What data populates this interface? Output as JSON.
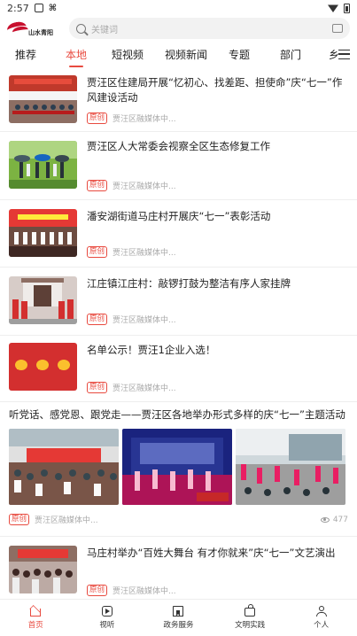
{
  "status_bar": {
    "time": "2:57",
    "indicators": [
      "wifi-icon",
      "battery-icon"
    ]
  },
  "header": {
    "logo_text": "山水青阳",
    "search_placeholder": "关键词"
  },
  "tabs": [
    {
      "label": "推荐",
      "active": false
    },
    {
      "label": "本地",
      "active": true
    },
    {
      "label": "短视频",
      "active": false
    },
    {
      "label": "视频新闻",
      "active": false
    },
    {
      "label": "专题",
      "active": false
    },
    {
      "label": "部门",
      "active": false
    },
    {
      "label": "乡",
      "active": false
    }
  ],
  "feed": [
    {
      "title": "贾汪区住建局开展“忆初心、找差距、担使命”庆“七一”作风建设活动",
      "badge": "原创",
      "source": "贾汪区融媒体中..."
    },
    {
      "title": "贾汪区人大常委会视察全区生态修复工作",
      "badge": "原创",
      "source": "贾汪区融媒体中..."
    },
    {
      "title": "潘安湖街道马庄村开展庆“七一”表彰活动",
      "badge": "原创",
      "source": "贾汪区融媒体中..."
    },
    {
      "title": "江庄镇江庄村：敲锣打鼓为整洁有序人家挂牌",
      "badge": "原创",
      "source": "贾汪区融媒体中..."
    },
    {
      "title": "名单公示！贾汪1企业入选！",
      "badge": "原创",
      "source": "贾汪区融媒体中..."
    }
  ],
  "gallery_item": {
    "title": "听党话、感党恩、跟党走——贾汪区各地举办形式多样的庆“七一”主题活动",
    "badge": "原创",
    "source": "贾汪区融媒体中...",
    "views": "477"
  },
  "last_item": {
    "title": "马庄村举办“百姓大舞台 有才你就来”庆“七一”文艺演出",
    "badge": "原创",
    "source": "贾汪区融媒体中..."
  },
  "bottom_nav": [
    {
      "label": "首页",
      "icon": "home-icon",
      "active": true
    },
    {
      "label": "视听",
      "icon": "play-icon",
      "active": false
    },
    {
      "label": "政务服务",
      "icon": "bookmark-icon",
      "active": false
    },
    {
      "label": "文明实践",
      "icon": "bag-icon",
      "active": false
    },
    {
      "label": "个人",
      "icon": "user-icon",
      "active": false
    }
  ]
}
